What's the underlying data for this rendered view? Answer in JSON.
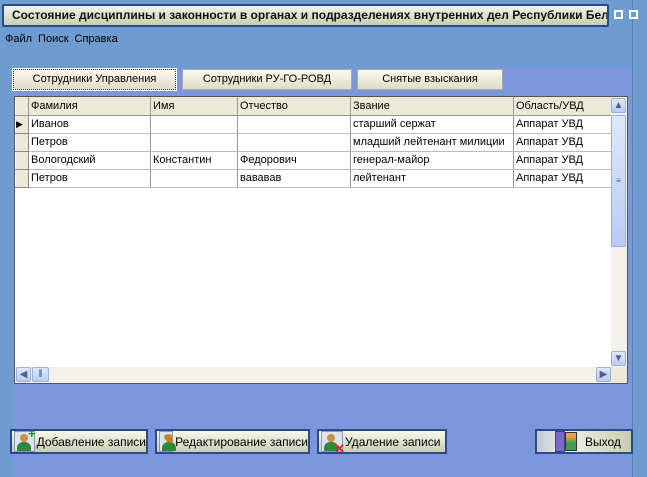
{
  "window": {
    "title": "Состояние дисциплины и законности в органах и подразделениях внутренних дел Республики Бела..."
  },
  "menu": [
    "Файл",
    "Поиск",
    "Справка"
  ],
  "tabs": [
    {
      "label": "Сотрудники Управления",
      "active": true
    },
    {
      "label": "Сотрудники РУ-ГО-РОВД"
    },
    {
      "label": "Снятые взыскания"
    }
  ],
  "table": {
    "columns": [
      "Фамилия",
      "Имя",
      "Отчество",
      "Звание",
      "Область/УВД"
    ],
    "rows": [
      [
        "Иванов",
        "",
        "",
        "старший сержат",
        "Аппарат УВД"
      ],
      [
        "Петров",
        "",
        "",
        "младший лейтенант милиции",
        "Аппарат УВД"
      ],
      [
        "Вологодский",
        "Константин",
        "Федорович",
        "генерал-майор",
        "Аппарат УВД"
      ],
      [
        "Петров",
        "",
        "вававав",
        "лейтенант",
        "Аппарат УВД"
      ]
    ]
  },
  "buttons": {
    "add": "Добавление записи",
    "edit": "Редактирование записи",
    "delete": "Удаление записи",
    "exit": "Выход"
  }
}
